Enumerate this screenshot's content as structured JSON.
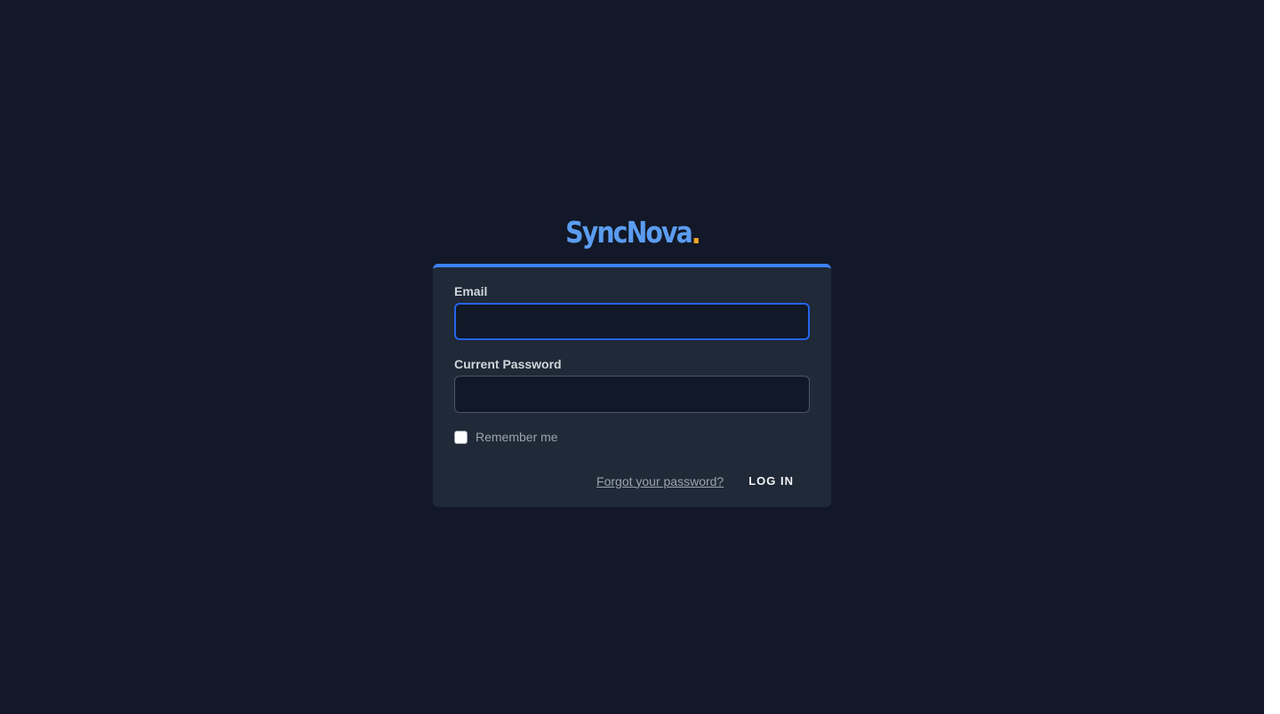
{
  "brand": {
    "name": "SyncNova",
    "accent_color": "#5b9cf0",
    "dot_color": "#f5a524"
  },
  "form": {
    "email_label": "Email",
    "email_value": "",
    "password_label": "Current Password",
    "password_value": "",
    "remember_label": "Remember me",
    "remember_checked": false,
    "forgot_label": "Forgot your password?",
    "login_label": "LOG IN"
  },
  "colors": {
    "background": "#121827",
    "card": "#1f2937",
    "card_top_border": "#3b82f6",
    "focus_border": "#2563eb"
  }
}
